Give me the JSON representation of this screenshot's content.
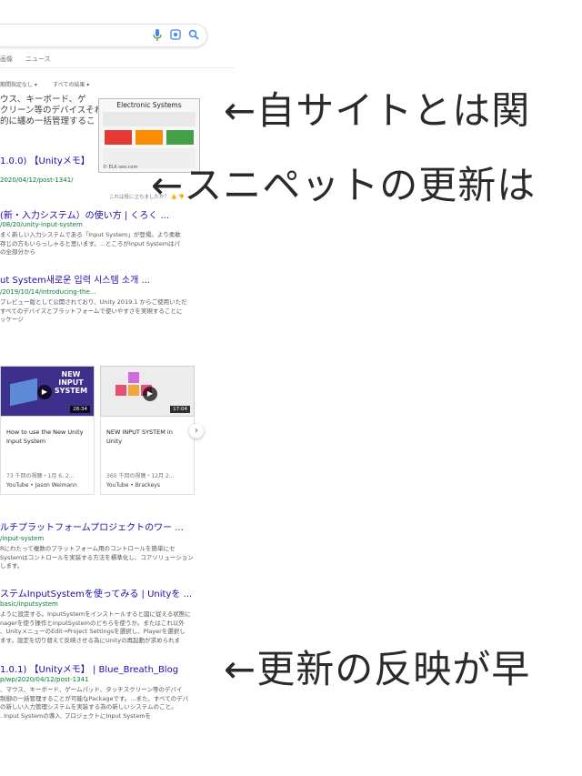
{
  "search": {
    "mic_icon": "mic-icon",
    "lens_icon": "lens-icon",
    "search_icon": "search-icon"
  },
  "tabs": [
    "画像",
    "ニュース"
  ],
  "tools": [
    "期間指定なし",
    "すべての結果"
  ],
  "snippet": {
    "text": "ウス、キーボード、ゲ\nクリーン等のデバイスそれ\n的に纏め一括管理するこ",
    "image_title": "Electronic Systems",
    "image_source": "© ELK seo.com",
    "link": "1.0.0) 【Unityメモ】",
    "url": "2020/04/12/post-1341/",
    "feedback": "これは役に立ちましたか？"
  },
  "results": [
    {
      "title": "(新・入力システム）の使い方 | くろく ...",
      "url": "/08/20/unity-input-system",
      "desc": "まく新しい入力システムである「Input System」が登場。より柔軟\n存じの方もいらっしゃると思います。...ところがInput Systemはパ\nの全部分から"
    },
    {
      "title": "ut System새로운 입력 시스템 소개 ...",
      "url": "/2019/10/14/introducing-the...",
      "desc": "プレビュー版として公開されており、Unity 2019.1 からご使用いただ\nすべてのデバイスとプラットフォームで使いやすさを実現することに\nッケージ"
    },
    {
      "title": "ルチプラットフォームプロジェクトのワー ...",
      "url": "/input-system",
      "desc": "Rにわたって複数のプラットフォーム用のコントロールを簡単にセ\nSystemはコントロールを実装する方法を標準化し、コアソリューション\nします。"
    },
    {
      "title": "ステムInputSystemを使ってみる | Unityを ...",
      "url": "basic/inputsystem",
      "desc": "ように設定する。InputSystemをインストールすると図に従える状態に\nnagerを使う操作とInputSystemのどちらを使うか。またはこれ以外\n、UnityメニューのEdit→Project Settingsを選択し、Playerを選択し\nます。設定を切り替えて反映させる為にUnityの再起動が求められま"
    },
    {
      "title": "1.0.1) 【Unityメモ】 | Blue_Breath_Blog",
      "url": "p/wp/2020/04/12/post-1341",
      "desc": "、マウス、キーボード、ゲームパッド、タッチスクリーン等のデバイ\n制御の一括管理することが可能なPackageです。...また、すべてのデバ\nの新しい入力管理システムを実装する為の新しいシステムのこと。\n. Input Systemの導入. プロジェクトにInput Systemを"
    }
  ],
  "videos": [
    {
      "thumb_label": "NEW\nINPUT\nSYSTEM",
      "duration": "28:34",
      "title": "How to use the New Unity\nInput System",
      "meta": "73 千回の視聴・1月 6, 2...",
      "source": "YouTube • Jason Weimann"
    },
    {
      "thumb_label": "",
      "duration": "17:04",
      "title": "NEW INPUT SYSTEM in\nUnity",
      "meta": "360 千回の視聴・12月 2...",
      "source": "YouTube • Brackeys"
    }
  ],
  "annotations": [
    "←自サイトとは関",
    "←スニペットの更新は",
    "←更新の反映が早"
  ]
}
